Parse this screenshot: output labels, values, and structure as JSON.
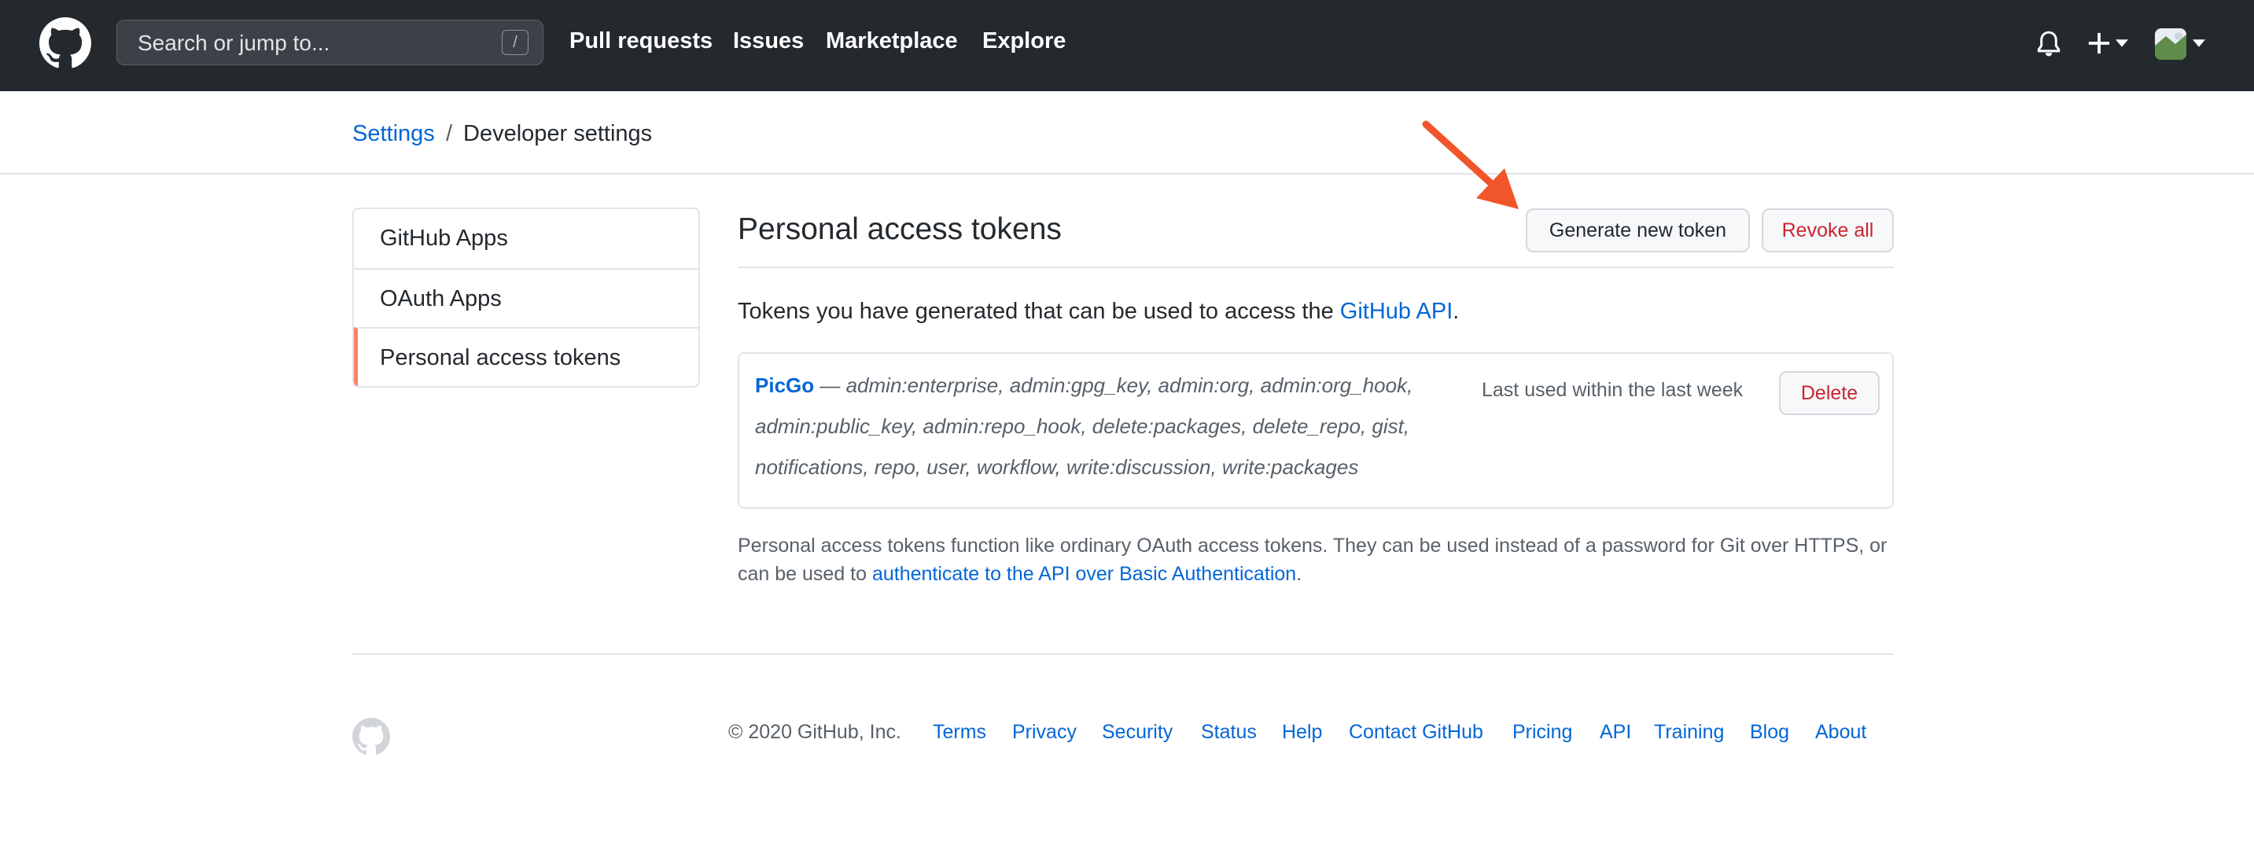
{
  "header": {
    "search_placeholder": "Search or jump to...",
    "search_key": "/",
    "nav": [
      "Pull requests",
      "Issues",
      "Marketplace",
      "Explore"
    ],
    "icons": [
      "github-logo",
      "bell-icon",
      "plus-icon",
      "chevron-down-icon",
      "avatar"
    ]
  },
  "breadcrumb": {
    "parent": "Settings",
    "separator": "/",
    "current": "Developer settings"
  },
  "sidebar": {
    "items": [
      {
        "label": "GitHub Apps",
        "selected": false
      },
      {
        "label": "OAuth Apps",
        "selected": false
      },
      {
        "label": "Personal access tokens",
        "selected": true
      }
    ]
  },
  "main": {
    "title": "Personal access tokens",
    "generate_label": "Generate new token",
    "revoke_label": "Revoke all",
    "intro_text": "Tokens you have generated that can be used to access the ",
    "intro_link": "GitHub API",
    "intro_end": ".",
    "token": {
      "name": "PicGo",
      "dash": " — ",
      "scopes": "admin:enterprise, admin:gpg_key, admin:org, admin:org_hook, admin:public_key, admin:repo_hook, delete:packages, delete_repo, gist, notifications, repo, user, workflow, write:discussion, write:packages",
      "last_used": "Last used within the last week",
      "delete_label": "Delete"
    },
    "footnote_text": "Personal access tokens function like ordinary OAuth access tokens. They can be used instead of a password for Git over HTTPS, or can be used to ",
    "footnote_link": "authenticate to the API over Basic Authentication",
    "footnote_end": "."
  },
  "footer": {
    "copyright": "© 2020 GitHub, Inc.",
    "links": [
      "Terms",
      "Privacy",
      "Security",
      "Status",
      "Help",
      "Contact GitHub",
      "Pricing",
      "API",
      "Training",
      "Blog",
      "About"
    ]
  },
  "colors": {
    "header_bg": "#24292e",
    "link": "#0366d6",
    "danger": "#cb2431",
    "selected_accent": "#f9826c",
    "annotation_arrow": "#f0562a"
  }
}
